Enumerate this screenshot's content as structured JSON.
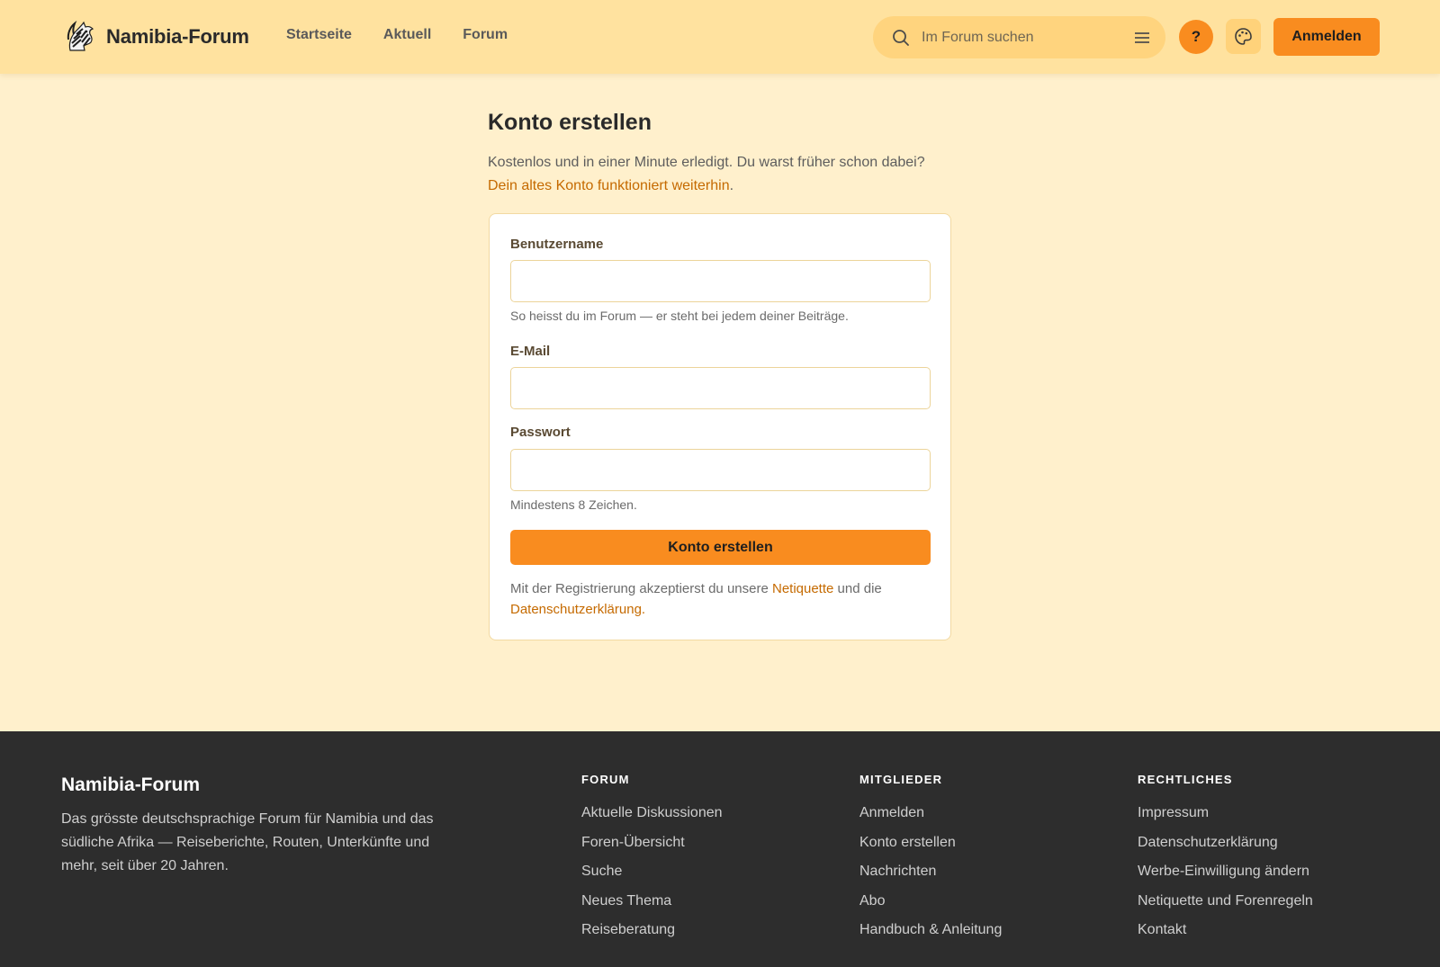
{
  "header": {
    "brand": "Namibia-Forum",
    "nav": [
      "Startseite",
      "Aktuell",
      "Forum"
    ],
    "search_placeholder": "Im Forum suchen",
    "help_label": "?",
    "login_label": "Anmelden"
  },
  "main": {
    "title": "Konto erstellen",
    "intro_text": "Kostenlos und in einer Minute erledigt. Du warst früher schon dabei?",
    "intro_link": "Dein altes Konto funktioniert weiterhin",
    "intro_link_suffix": ".",
    "form": {
      "username_label": "Benutzername",
      "username_value": "",
      "username_hint": "So heisst du im Forum — er steht bei jedem deiner Beiträge.",
      "email_label": "E-Mail",
      "email_value": "",
      "password_label": "Passwort",
      "password_value": "",
      "password_hint": "Mindestens 8 Zeichen.",
      "submit_label": "Konto erstellen",
      "terms_prefix": "Mit der Registrierung akzeptierst du unsere ",
      "terms_link1": "Netiquette",
      "terms_middle": " und die",
      "terms_link2": "Datenschutzerklärung",
      "terms_suffix": "."
    }
  },
  "footer": {
    "brand": "Namibia-Forum",
    "description": "Das grösste deutschsprachige Forum für Namibia und das südliche Afrika — Reiseberichte, Routen, Unterkünfte und mehr, seit über 20 Jahren.",
    "columns": [
      {
        "title": "FORUM",
        "items": [
          "Aktuelle Diskussionen",
          "Foren-Übersicht",
          "Suche",
          "Neues Thema",
          "Reiseberatung"
        ]
      },
      {
        "title": "MITGLIEDER",
        "items": [
          "Anmelden",
          "Konto erstellen",
          "Nachrichten",
          "Abo",
          "Handbuch & Anleitung"
        ]
      },
      {
        "title": "RECHTLICHES",
        "items": [
          "Impressum",
          "Datenschutzerklärung",
          "Werbe-Einwilligung ändern",
          "Netiquette und Forenregeln",
          "Kontakt"
        ]
      }
    ]
  },
  "colors": {
    "page_bg": "#fff0cc",
    "header_bg": "#ffe29f",
    "accent": "#f98c1f",
    "link": "#c56a00",
    "footer_bg": "#2d2d2d"
  },
  "icons": {
    "logo": "zebra-logo-icon",
    "search": "search-icon",
    "filter": "filter-lines-icon",
    "theme": "palette-icon"
  }
}
